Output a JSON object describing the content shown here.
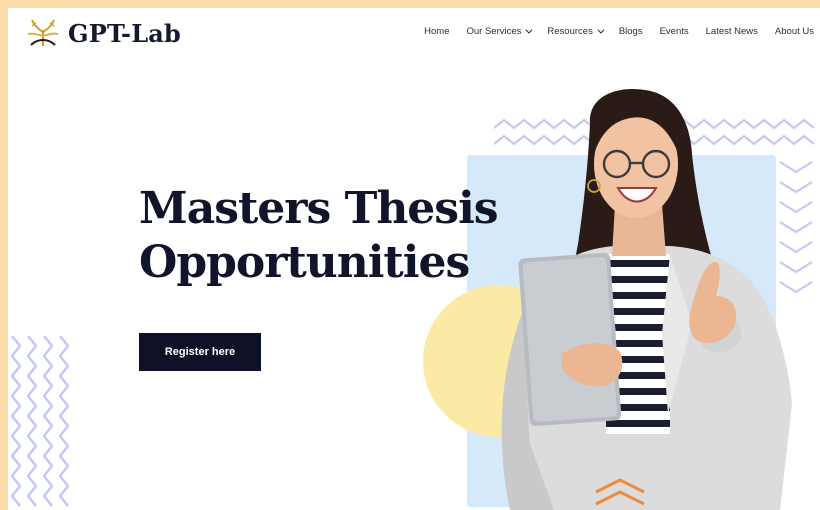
{
  "header": {
    "brand": "GPT-Lab",
    "nav": [
      {
        "label": "Home",
        "dropdown": false
      },
      {
        "label": "Our Services",
        "dropdown": true
      },
      {
        "label": "Resources",
        "dropdown": true
      },
      {
        "label": "Blogs",
        "dropdown": false
      },
      {
        "label": "Events",
        "dropdown": false
      },
      {
        "label": "Latest News",
        "dropdown": false
      },
      {
        "label": "About Us",
        "dropdown": false
      }
    ]
  },
  "hero": {
    "title_line1": "Masters Thesis",
    "title_line2": "Opportunities",
    "cta_label": "Register here"
  },
  "colors": {
    "frame": "#fcdca8",
    "ink": "#11142b",
    "button": "#0f1128",
    "panel_blue": "#d6e9fa",
    "circle_yellow": "#fbeaa6",
    "zigzag_lavender": "#c4c8f4",
    "zigzag_orange": "#ef8a3a",
    "logo_gold": "#d6a624"
  }
}
